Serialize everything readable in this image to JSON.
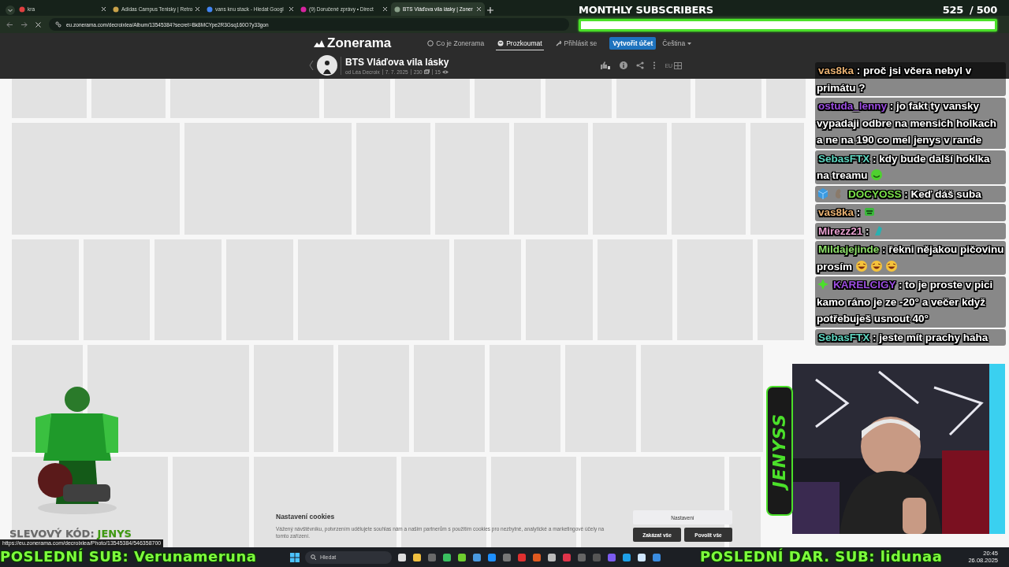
{
  "browser": {
    "tabs": [
      {
        "title": "kra",
        "selected": false
      },
      {
        "title": "Adidas Campus Tenisky | Retro",
        "selected": false
      },
      {
        "title": "vans knu stack - Hledat Googl",
        "selected": false
      },
      {
        "title": "(9) Doručené zprávy • Direct",
        "selected": false
      },
      {
        "title": "BTS Vláďova vila lásky | Zoner",
        "selected": true
      }
    ],
    "url": "eu.zonerama.com/decroixlea/Album/13545384?secret=Bk8MCYpe2R3Gsq160O7y33gon"
  },
  "site": {
    "logo": "Zonerama",
    "nav": [
      {
        "label": "Co je Zonerama",
        "selected": false
      },
      {
        "label": "Prozkoumat",
        "selected": true
      },
      {
        "label": "Přihlásit se",
        "selected": false
      }
    ],
    "signup": "Vytvořit účet",
    "language": "Čeština",
    "album": {
      "title": "BTS Vláďova vila lásky",
      "author_prefix": "od",
      "author": "Léa Decroix",
      "date": "7. 7. 2025",
      "photos": "230",
      "views": "15",
      "region": "EU"
    }
  },
  "cookies": {
    "title": "Nastavení cookies",
    "text": "Vážený návštěvníku, potvrzením udělujete souhlas nám a našim partnerům s použitím cookies pro nezbytné, analytické a marketingové účely na tomto zařízení.",
    "buttons": [
      {
        "label": "Nastavení",
        "kind": "secondary"
      },
      {
        "label": "Zakázat vše",
        "kind": "primary"
      },
      {
        "label": "Povolit vše",
        "kind": "primary"
      }
    ]
  },
  "status_url": "https://eu.zonerama.com/decroixlea/Photo/13545384/546358700",
  "stream": {
    "goal": {
      "title": "MONTHLY SUBSCRIBERS",
      "count": "525",
      "target": "/ 500",
      "level": 1
    },
    "chat": [
      {
        "user": "vas8ka",
        "color": "#e8b070",
        "sep": ":",
        "text": "proč jsi včera nebyl v primátu ?"
      },
      {
        "user": "ostuda_lenny",
        "color": "#9b4de0",
        "sep": ":",
        "text": "jo fakt ty vansky vypadaji odbre na mensich holkach a ne na 190 co mel jenys v rande"
      },
      {
        "user": "SebasFTX",
        "color": "#5fd6c0",
        "sep": ":",
        "text": "kdy bude další hoklka na treamu",
        "emotes": [
          {
            "kind": "smile"
          }
        ]
      },
      {
        "user": "DOCYOSS",
        "color": "#7be04a",
        "sep": ":",
        "text": "Keď dáš suba",
        "badges": [
          {
            "kind": "cube"
          },
          {
            "kind": "squirrel"
          }
        ]
      },
      {
        "user": "vas8ka",
        "color": "#e8b070",
        "sep": ":",
        "emotes": [
          {
            "kind": "frog"
          }
        ]
      },
      {
        "user": "Mirezz21",
        "color": "#e8a0d0",
        "sep": ":",
        "emotes": [
          {
            "kind": "pepe"
          }
        ]
      },
      {
        "user": "Mildajejinde",
        "color": "#8ee06a",
        "sep": ":",
        "text": "řekni nějakou pičovinu prosím",
        "emotes": [
          {
            "kind": "laugh"
          },
          {
            "kind": "laugh"
          },
          {
            "kind": "laugh"
          }
        ]
      },
      {
        "user": "KARELCIGY",
        "color": "#9b4de0",
        "sep": ":",
        "text": "to je proste v pici kamo ráno je ze -20° a večer když potřebuješ usnout 40°",
        "badges": [
          {
            "kind": "gem"
          }
        ]
      },
      {
        "user": "SebasFTX",
        "color": "#5fd6c0",
        "sep": ":",
        "text": "jeste mít prachy haha"
      }
    ],
    "promo": {
      "label": "SLEVOVÝ KÓD:",
      "code": "JENYS"
    },
    "logo": "JENYSS",
    "last_sub": "POSLEDNÍ SUB: Verunameruna",
    "last_gift": "POSLEDNÍ DAR. SUB: lidunaa"
  },
  "taskbar": {
    "search": "Hledat",
    "time": "20:45",
    "date": "26.08.2025"
  }
}
